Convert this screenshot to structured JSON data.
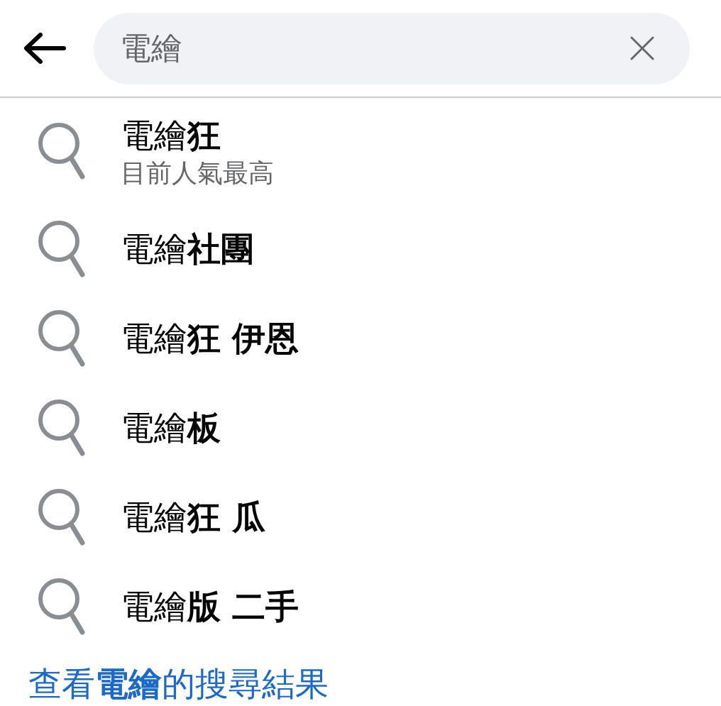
{
  "search": {
    "value": "電繪"
  },
  "suggestions": [
    {
      "text": "電繪**狂**",
      "subtitle": "目前人氣最高"
    },
    {
      "text": "電繪**社團**"
    },
    {
      "text": "電繪**狂 伊恩**"
    },
    {
      "text": "電繪**板**"
    },
    {
      "text": "電繪**狂 瓜**"
    },
    {
      "text": "電繪**版 二手**"
    }
  ],
  "see_all_link": {
    "text": "查看**電繪**的搜尋結果"
  }
}
